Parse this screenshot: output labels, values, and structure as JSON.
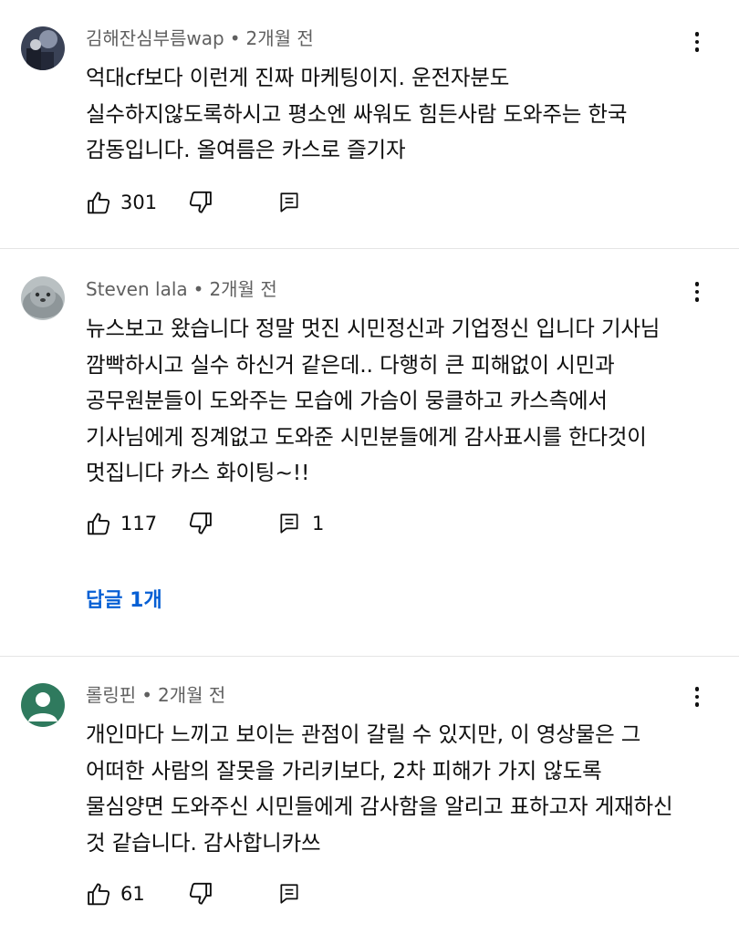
{
  "comments": [
    {
      "author": "김해잔심부름wap",
      "time": "2개월 전",
      "text": "억대cf보다 이런게 진짜 마케팅이지. 운전자분도 실수하지않도록하시고 평소엔 싸워도 힘든사람 도와주는 한국 감동입니다. 올여름은 카스로 즐기자",
      "likes": "301",
      "replies_count": "",
      "avatar": "dark-photo-avatar",
      "icons": {
        "like": "thumb-up-icon",
        "dislike": "thumb-down-icon",
        "reply": "reply-icon",
        "menu": "more-vert-icon"
      }
    },
    {
      "author": "Steven lala",
      "time": "2개월 전",
      "text": "뉴스보고 왔습니다 정말 멋진 시민정신과 기업정신 입니다 기사님 깜빡하시고 실수 하신거 같은데.. 다행히 큰 피해없이 시민과 공무원분들이 도와주는 모습에 가슴이 뭉클하고 카스측에서 기사님에게 징계없고 도와준 시민분들에게 감사표시를 한다것이 멋집니다 카스 화이팅~!!",
      "likes": "117",
      "replies_count": "1",
      "replies_link": "답글 1개",
      "avatar": "seal-photo-avatar",
      "icons": {
        "like": "thumb-up-icon",
        "dislike": "thumb-down-icon",
        "reply": "reply-icon",
        "menu": "more-vert-icon"
      }
    },
    {
      "author": "롤링핀",
      "time": "2개월 전",
      "text": "개인마다 느끼고 보이는 관점이 갈릴 수 있지만, 이 영상물은 그 어떠한 사람의 잘못을 가리키보다, 2차 피해가 가지 않도록 물심양면 도와주신 시민들에게 감사함을 알리고 표하고자 게재하신 것 같습니다. 감사합니카쓰",
      "likes": "61",
      "replies_count": "",
      "avatar": "default-user-avatar",
      "icons": {
        "like": "thumb-up-icon",
        "dislike": "thumb-down-icon",
        "reply": "reply-icon",
        "menu": "more-vert-icon"
      }
    }
  ],
  "colors": {
    "text": "#0f0f0f",
    "meta": "#606060",
    "link": "#065fd4",
    "divider": "#e5e5e5",
    "default_avatar_bg": "#2f7a5e"
  }
}
